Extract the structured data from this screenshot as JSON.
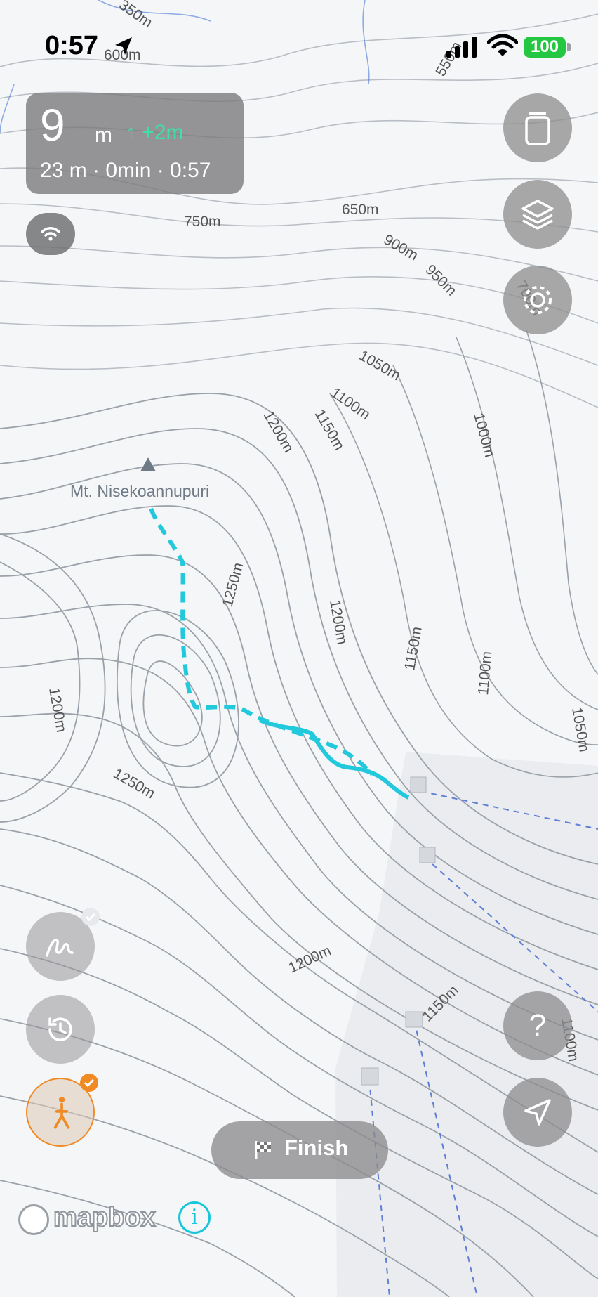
{
  "status_bar": {
    "time": "0:57",
    "battery": "100"
  },
  "stats_panel": {
    "altitude_value": "9",
    "altitude_unit": "m",
    "elevation_gain": "↑ +2m",
    "summary": "23 m · 0min · 0:57"
  },
  "map": {
    "peak_name": "Mt. Nisekoannupuri",
    "contour_labels": [
      "350m",
      "600m",
      "550m",
      "750m",
      "650m",
      "900m",
      "950m",
      "700m",
      "1050m",
      "1100m",
      "1000m",
      "1200m",
      "1150m",
      "1250m",
      "1200m",
      "1150m",
      "1100m",
      "1050m",
      "1200m",
      "1250m",
      "1200m",
      "1150m",
      "1100m"
    ],
    "attribution": "mapbox"
  },
  "right_controls": {
    "help_label": "?"
  },
  "bottom": {
    "finish_label": "Finish",
    "info_label": "i"
  },
  "icons": [
    "location-arrow-icon",
    "signal-icon",
    "wifi-icon",
    "battery-icon",
    "wifi-icon",
    "bottle-icon",
    "layers-icon",
    "gear-icon",
    "draw-icon",
    "history-icon",
    "hiker-icon",
    "check-icon",
    "help-icon",
    "navigate-icon",
    "flag-icon",
    "mapbox-logo-icon",
    "info-icon",
    "peak-icon"
  ],
  "colors": {
    "track_recorded": "#22c9dc",
    "track_planned": "#22c9dc",
    "lift_lines": "#5f7fd6",
    "gain": "#3ee0a8",
    "accent_badge": "#f08a24"
  }
}
